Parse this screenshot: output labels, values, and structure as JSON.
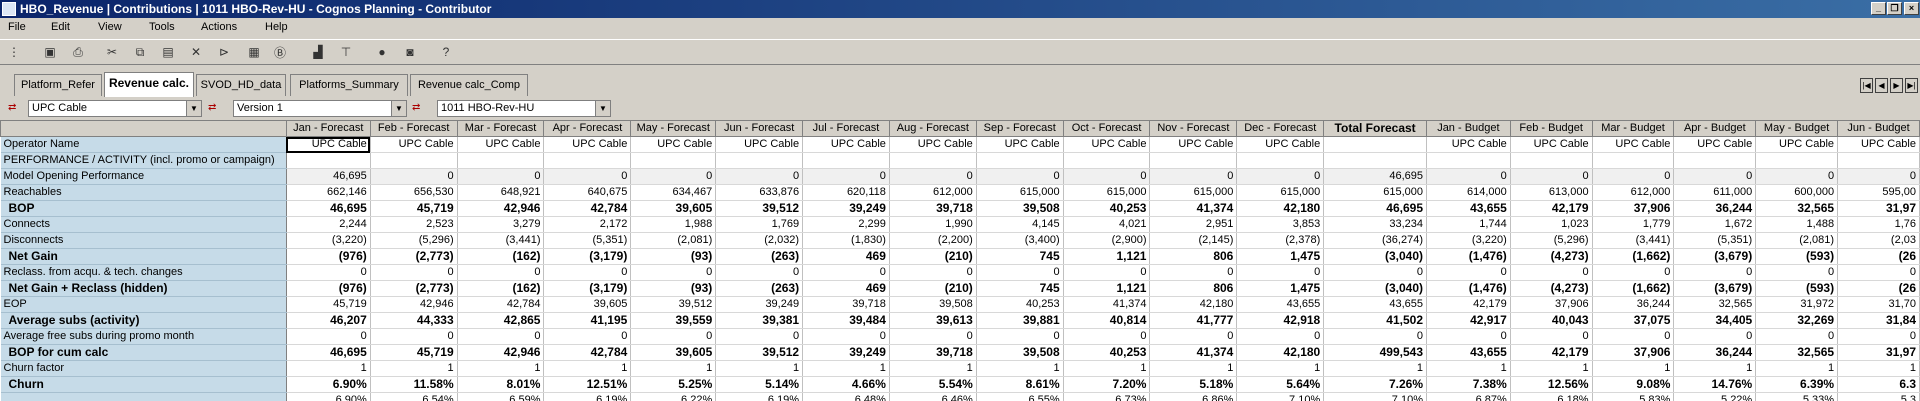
{
  "window": {
    "title": "HBO_Revenue | Contributions | 1011 HBO-Rev-HU - Cognos Planning - Contributor"
  },
  "menu": [
    "File",
    "Edit",
    "View",
    "Tools",
    "Actions",
    "Help"
  ],
  "tabs": [
    "Platform_Refer",
    "Revenue calc.",
    "SVOD_HD_data",
    "Platforms_Summary",
    "Revenue calc_Comp"
  ],
  "active_tab": 1,
  "selectors": {
    "platform": "UPC Cable",
    "version": "Version 1",
    "entity": "1011 HBO-Rev-HU"
  },
  "columns": [
    "Jan - Forecast",
    "Feb - Forecast",
    "Mar - Forecast",
    "Apr - Forecast",
    "May - Forecast",
    "Jun - Forecast",
    "Jul - Forecast",
    "Aug - Forecast",
    "Sep - Forecast",
    "Oct - Forecast",
    "Nov - Forecast",
    "Dec - Forecast",
    "Total Forecast",
    "Jan - Budget",
    "Feb - Budget",
    "Mar - Budget",
    "Apr - Budget",
    "May - Budget",
    "Jun - Budget"
  ],
  "rows": [
    {
      "label": "Operator Name",
      "values": [
        "UPC Cable",
        "UPC Cable",
        "UPC Cable",
        "UPC Cable",
        "UPC Cable",
        "UPC Cable",
        "UPC Cable",
        "UPC Cable",
        "UPC Cable",
        "UPC Cable",
        "UPC Cable",
        "UPC Cable",
        "",
        "UPC Cable",
        "UPC Cable",
        "UPC Cable",
        "UPC Cable",
        "UPC Cable",
        "UPC Cable"
      ]
    },
    {
      "label": "PERFORMANCE / ACTIVITY (incl. promo or campaign)",
      "values": [
        "",
        "",
        "",
        "",
        "",
        "",
        "",
        "",
        "",
        "",
        "",
        "",
        "",
        "",
        "",
        "",
        "",
        "",
        ""
      ]
    },
    {
      "label": "Model Opening Performance",
      "values": [
        "46,695",
        "0",
        "0",
        "0",
        "0",
        "0",
        "0",
        "0",
        "0",
        "0",
        "0",
        "0",
        "46,695",
        "0",
        "0",
        "0",
        "0",
        "0",
        "0"
      ]
    },
    {
      "label": "Reachables",
      "values": [
        "662,146",
        "656,530",
        "648,921",
        "640,675",
        "634,467",
        "633,876",
        "620,118",
        "612,000",
        "615,000",
        "615,000",
        "615,000",
        "615,000",
        "615,000",
        "614,000",
        "613,000",
        "612,000",
        "611,000",
        "600,000",
        "595,00"
      ]
    },
    {
      "label": "BOP",
      "bold": true,
      "values": [
        "46,695",
        "45,719",
        "42,946",
        "42,784",
        "39,605",
        "39,512",
        "39,249",
        "39,718",
        "39,508",
        "40,253",
        "41,374",
        "42,180",
        "46,695",
        "43,655",
        "42,179",
        "37,906",
        "36,244",
        "32,565",
        "31,97"
      ]
    },
    {
      "label": "Connects",
      "values": [
        "2,244",
        "2,523",
        "3,279",
        "2,172",
        "1,988",
        "1,769",
        "2,299",
        "1,990",
        "4,145",
        "4,021",
        "2,951",
        "3,853",
        "33,234",
        "1,744",
        "1,023",
        "1,779",
        "1,672",
        "1,488",
        "1,76"
      ]
    },
    {
      "label": "Disconnects",
      "values": [
        "(3,220)",
        "(5,296)",
        "(3,441)",
        "(5,351)",
        "(2,081)",
        "(2,032)",
        "(1,830)",
        "(2,200)",
        "(3,400)",
        "(2,900)",
        "(2,145)",
        "(2,378)",
        "(36,274)",
        "(3,220)",
        "(5,296)",
        "(3,441)",
        "(5,351)",
        "(2,081)",
        "(2,03"
      ]
    },
    {
      "label": "Net Gain",
      "bold": true,
      "values": [
        "(976)",
        "(2,773)",
        "(162)",
        "(3,179)",
        "(93)",
        "(263)",
        "469",
        "(210)",
        "745",
        "1,121",
        "806",
        "1,475",
        "(3,040)",
        "(1,476)",
        "(4,273)",
        "(1,662)",
        "(3,679)",
        "(593)",
        "(26"
      ]
    },
    {
      "label": "Reclass. from acqu. & tech. changes",
      "values": [
        "0",
        "0",
        "0",
        "0",
        "0",
        "0",
        "0",
        "0",
        "0",
        "0",
        "0",
        "0",
        "0",
        "0",
        "0",
        "0",
        "0",
        "0",
        "0"
      ]
    },
    {
      "label": "Net Gain + Reclass (hidden)",
      "bold": true,
      "values": [
        "(976)",
        "(2,773)",
        "(162)",
        "(3,179)",
        "(93)",
        "(263)",
        "469",
        "(210)",
        "745",
        "1,121",
        "806",
        "1,475",
        "(3,040)",
        "(1,476)",
        "(4,273)",
        "(1,662)",
        "(3,679)",
        "(593)",
        "(26"
      ]
    },
    {
      "label": "EOP",
      "values": [
        "45,719",
        "42,946",
        "42,784",
        "39,605",
        "39,512",
        "39,249",
        "39,718",
        "39,508",
        "40,253",
        "41,374",
        "42,180",
        "43,655",
        "43,655",
        "42,179",
        "37,906",
        "36,244",
        "32,565",
        "31,972",
        "31,70"
      ]
    },
    {
      "label": "Average subs (activity)",
      "bold": true,
      "values": [
        "46,207",
        "44,333",
        "42,865",
        "41,195",
        "39,559",
        "39,381",
        "39,484",
        "39,613",
        "39,881",
        "40,814",
        "41,777",
        "42,918",
        "41,502",
        "42,917",
        "40,043",
        "37,075",
        "34,405",
        "32,269",
        "31,84"
      ]
    },
    {
      "label": "Average free subs during promo month",
      "values": [
        "0",
        "0",
        "0",
        "0",
        "0",
        "0",
        "0",
        "0",
        "0",
        "0",
        "0",
        "0",
        "0",
        "0",
        "0",
        "0",
        "0",
        "0",
        "0"
      ]
    },
    {
      "label": "BOP for cum calc",
      "bold": true,
      "values": [
        "46,695",
        "45,719",
        "42,946",
        "42,784",
        "39,605",
        "39,512",
        "39,249",
        "39,718",
        "39,508",
        "40,253",
        "41,374",
        "42,180",
        "499,543",
        "43,655",
        "42,179",
        "37,906",
        "36,244",
        "32,565",
        "31,97"
      ]
    },
    {
      "label": "Churn factor",
      "values": [
        "1",
        "1",
        "1",
        "1",
        "1",
        "1",
        "1",
        "1",
        "1",
        "1",
        "1",
        "1",
        "1",
        "1",
        "1",
        "1",
        "1",
        "1",
        "1"
      ]
    },
    {
      "label": "Churn",
      "bold": true,
      "values": [
        "6.90%",
        "11.58%",
        "8.01%",
        "12.51%",
        "5.25%",
        "5.14%",
        "4.66%",
        "5.54%",
        "8.61%",
        "7.20%",
        "5.18%",
        "5.64%",
        "7.26%",
        "7.38%",
        "12.56%",
        "9.08%",
        "14.76%",
        "6.39%",
        "6.3"
      ]
    },
    {
      "label": "",
      "values": [
        "6.90%",
        "6.54%",
        "6.59%",
        "6.19%",
        "6.22%",
        "6.19%",
        "6.48%",
        "6.46%",
        "6.55%",
        "6.73%",
        "6.86%",
        "7.10%",
        "7.10%",
        "6.87%",
        "6.18%",
        "5.83%",
        "5.22%",
        "5.33%",
        "5.3"
      ]
    }
  ]
}
